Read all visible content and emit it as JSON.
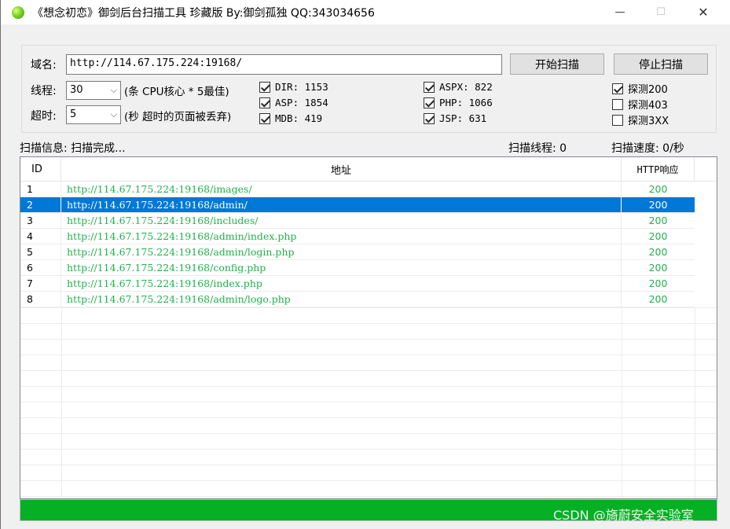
{
  "window": {
    "title": "《想念初恋》御剑后台扫描工具 珍藏版 By:御剑孤独 QQ:343034656",
    "minimize": "—",
    "maximize": "☐",
    "close": "✕"
  },
  "form": {
    "domain_label": "域名:",
    "domain_value": "http://114.67.175.224:19168/",
    "threads_label": "线程:",
    "threads_value": "30",
    "threads_hint": "(条 CPU核心 * 5最佳)",
    "timeout_label": "超时:",
    "timeout_value": "5",
    "timeout_hint": "(秒 超时的页面被丢弃)",
    "start_button": "开始扫描",
    "stop_button": "停止扫描"
  },
  "dictionaries": [
    {
      "label": "DIR: 1153",
      "checked": true
    },
    {
      "label": "ASP: 1854",
      "checked": true
    },
    {
      "label": "MDB: 419",
      "checked": true
    },
    {
      "label": "ASPX: 822",
      "checked": true
    },
    {
      "label": "PHP: 1066",
      "checked": true
    },
    {
      "label": "JSP: 631",
      "checked": true
    }
  ],
  "probes": [
    {
      "label": "探测200",
      "checked": true
    },
    {
      "label": "探测403",
      "checked": false
    },
    {
      "label": "探测3XX",
      "checked": false
    }
  ],
  "status": {
    "info": "扫描信息: 扫描完成...",
    "threads": "扫描线程: 0",
    "speed": "扫描速度: 0/秒"
  },
  "table": {
    "columns": [
      "ID",
      "地址",
      "HTTP响应"
    ],
    "selected_index": 1,
    "rows": [
      {
        "id": "1",
        "url": "http://114.67.175.224:19168/images/",
        "code": "200"
      },
      {
        "id": "2",
        "url": "http://114.67.175.224:19168/admin/",
        "code": "200"
      },
      {
        "id": "3",
        "url": "http://114.67.175.224:19168/includes/",
        "code": "200"
      },
      {
        "id": "4",
        "url": "http://114.67.175.224:19168/admin/index.php",
        "code": "200"
      },
      {
        "id": "5",
        "url": "http://114.67.175.224:19168/admin/login.php",
        "code": "200"
      },
      {
        "id": "6",
        "url": "http://114.67.175.224:19168/config.php",
        "code": "200"
      },
      {
        "id": "7",
        "url": "http://114.67.175.224:19168/index.php",
        "code": "200"
      },
      {
        "id": "8",
        "url": "http://114.67.175.224:19168/admin/logo.php",
        "code": "200"
      }
    ]
  },
  "progress": {
    "fraction": 1.0
  },
  "watermark": "CSDN @旖蔚安全实验室",
  "colors": {
    "url_text": "#22b14c",
    "selection": "#0078d7",
    "progress": "#06b025"
  }
}
